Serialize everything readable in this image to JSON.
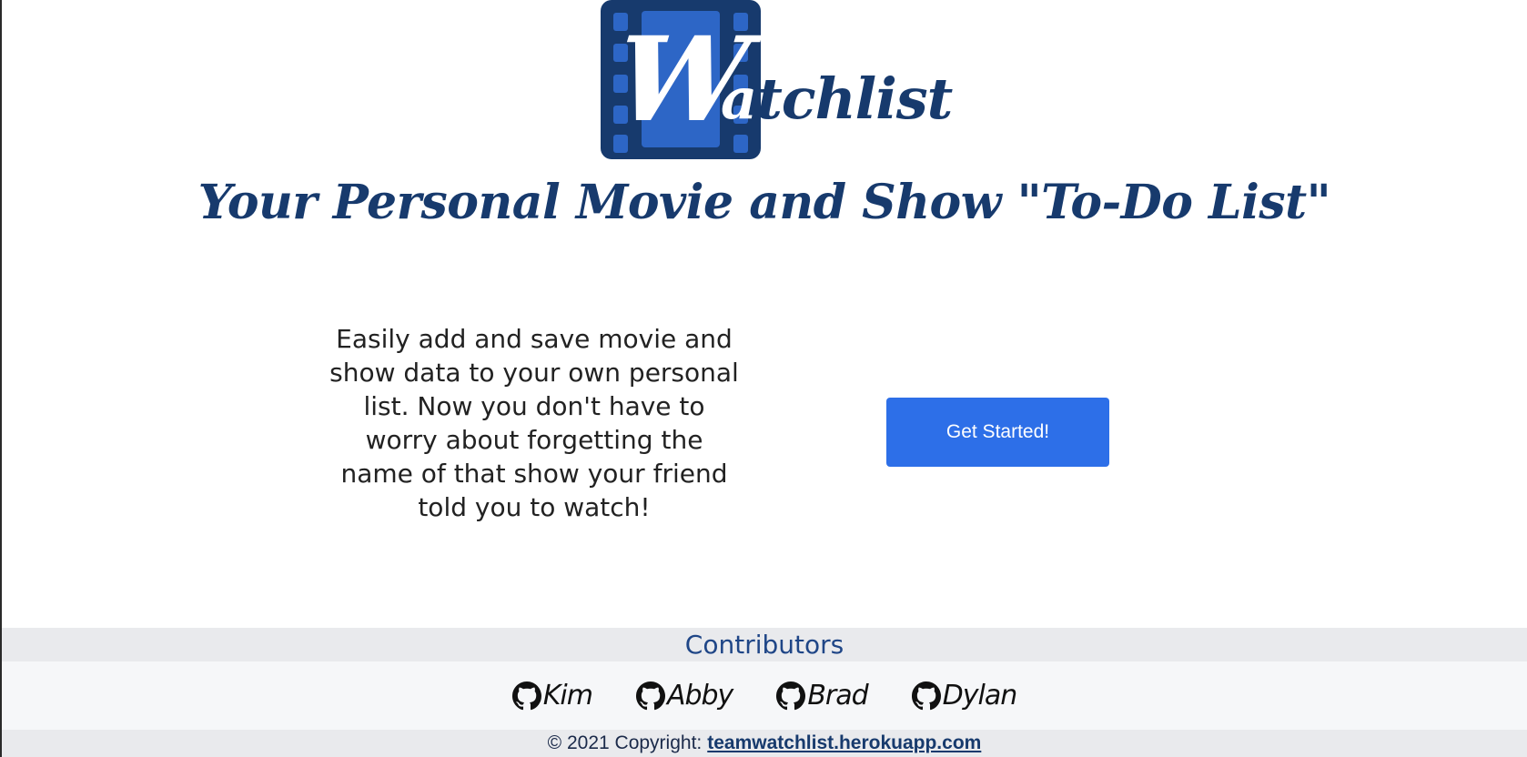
{
  "logo": {
    "big_letter": "W",
    "rest_first": "a",
    "rest": "tchlist"
  },
  "tagline": "Your Personal Movie and Show \"To-Do List\"",
  "blurb": "Easily add and save movie and show data to your own personal list. Now you don't have to worry about forgetting the name of that show your friend told you to watch!",
  "cta": {
    "label": "Get Started!"
  },
  "contributors": {
    "title": "Contributors",
    "people": [
      {
        "name": "Kim",
        "icon": "github-icon"
      },
      {
        "name": "Abby",
        "icon": "github-icon"
      },
      {
        "name": "Brad",
        "icon": "github-icon"
      },
      {
        "name": "Dylan",
        "icon": "github-icon"
      }
    ]
  },
  "footer": {
    "copyright": "© 2021 Copyright:",
    "link_text": "teamwatchlist.herokuapp.com"
  },
  "colors": {
    "brand_navy": "#173a6d",
    "film_blue": "#2d66c6",
    "button_blue": "#2d6fe8",
    "band_gray": "#e9eaed"
  }
}
